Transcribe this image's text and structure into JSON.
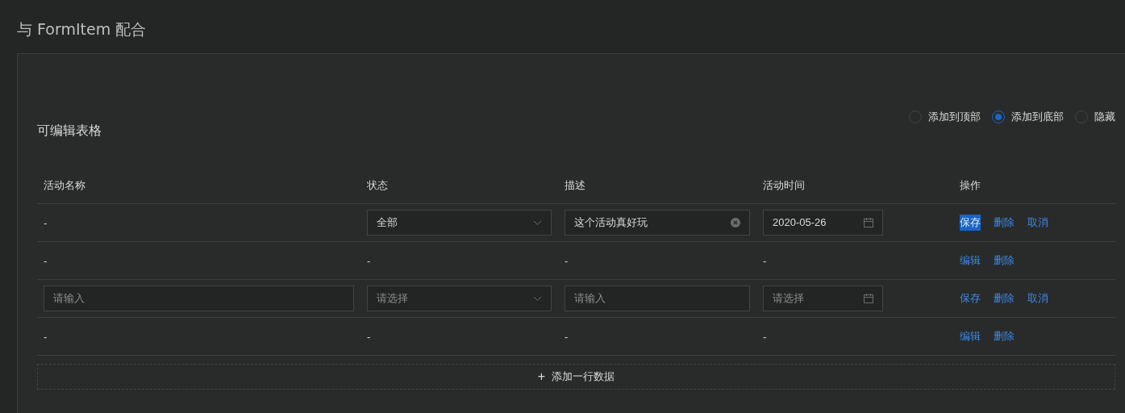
{
  "title": "与 FormItem 配合",
  "card": {
    "title": "可编辑表格",
    "position_options": [
      {
        "label": "添加到顶部",
        "selected": false
      },
      {
        "label": "添加到底部",
        "selected": true
      },
      {
        "label": "隐藏",
        "selected": false
      }
    ],
    "table": {
      "columns": [
        "活动名称",
        "状态",
        "描述",
        "活动时间",
        "操作"
      ],
      "rows": [
        {
          "cells": [
            {
              "kind": "text",
              "value": "-"
            },
            {
              "kind": "select",
              "value": "全部"
            },
            {
              "kind": "input",
              "value": "这个活动真好玩",
              "clear": true
            },
            {
              "kind": "date",
              "value": "2020-05-26"
            }
          ],
          "actions": [
            {
              "label": "保存",
              "highlighted": true
            },
            {
              "label": "删除",
              "highlighted": false
            },
            {
              "label": "取消",
              "highlighted": false
            }
          ]
        },
        {
          "cells": [
            {
              "kind": "text",
              "value": "-"
            },
            {
              "kind": "text",
              "value": "-"
            },
            {
              "kind": "text",
              "value": "-"
            },
            {
              "kind": "text",
              "value": "-"
            }
          ],
          "actions": [
            {
              "label": "编辑",
              "highlighted": false
            },
            {
              "label": "删除",
              "highlighted": false
            }
          ]
        },
        {
          "cells": [
            {
              "kind": "input",
              "placeholder": "请输入",
              "clear": false
            },
            {
              "kind": "select",
              "placeholder": "请选择"
            },
            {
              "kind": "input",
              "placeholder": "请输入",
              "clear": false
            },
            {
              "kind": "date",
              "placeholder": "请选择"
            }
          ],
          "actions": [
            {
              "label": "保存",
              "highlighted": false
            },
            {
              "label": "删除",
              "highlighted": false
            },
            {
              "label": "取消",
              "highlighted": false
            }
          ]
        },
        {
          "cells": [
            {
              "kind": "text",
              "value": "-"
            },
            {
              "kind": "text",
              "value": "-"
            },
            {
              "kind": "text",
              "value": "-"
            },
            {
              "kind": "text",
              "value": "-"
            }
          ],
          "actions": [
            {
              "label": "编辑",
              "highlighted": false
            },
            {
              "label": "删除",
              "highlighted": false
            }
          ]
        }
      ]
    },
    "add_button": {
      "icon": "+",
      "label": "添加一行数据"
    }
  }
}
